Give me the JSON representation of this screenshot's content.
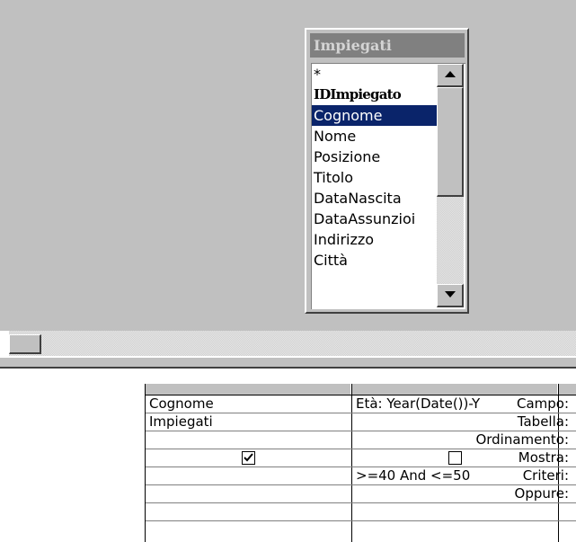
{
  "field_list": {
    "title": "Impiegati",
    "fields": [
      "*",
      "IDImpiegato",
      "Cognome",
      "Nome",
      "Posizione",
      "Titolo",
      "DataNascita",
      "DataAssunzioi",
      "Indirizzo",
      "Città"
    ],
    "selected": "Cognome",
    "primary_key": "IDImpiegato"
  },
  "grid": {
    "row_labels": {
      "campo": "Campo:",
      "tabella": "Tabella:",
      "ordinamento": "Ordinamento:",
      "mostra": "Mostra:",
      "criteri": "Criteri:",
      "oppure": "Oppure:"
    },
    "columns": [
      {
        "campo": "Cognome",
        "tabella": "Impiegati",
        "ordinamento": "",
        "mostra": true,
        "criteri": "",
        "oppure": ""
      },
      {
        "campo": "Età: Year(Date())-Y",
        "tabella": "",
        "ordinamento": "",
        "mostra": false,
        "criteri": ">=40 And <=50",
        "oppure": ""
      }
    ]
  },
  "colors": {
    "pane_bg": "#c0c0c0",
    "selection": "#0a246a",
    "title_inactive": "#808080"
  }
}
